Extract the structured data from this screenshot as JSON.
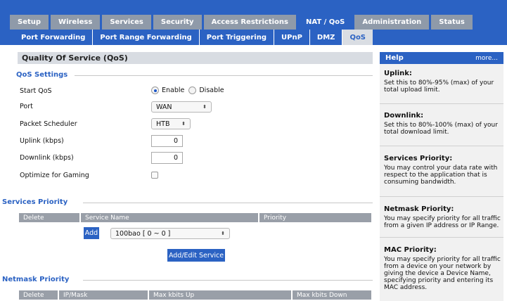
{
  "top_tabs": [
    {
      "label": "Setup"
    },
    {
      "label": "Wireless"
    },
    {
      "label": "Services"
    },
    {
      "label": "Security"
    },
    {
      "label": "Access Restrictions"
    },
    {
      "label": "NAT / QoS"
    },
    {
      "label": "Administration"
    },
    {
      "label": "Status"
    }
  ],
  "active_top_tab": "NAT / QoS",
  "sub_tabs": [
    {
      "label": "Port Forwarding"
    },
    {
      "label": "Port Range Forwarding"
    },
    {
      "label": "Port Triggering"
    },
    {
      "label": "UPnP"
    },
    {
      "label": "DMZ"
    },
    {
      "label": "QoS"
    }
  ],
  "active_sub_tab": "QoS",
  "page_title": "Quality Of Service (QoS)",
  "qos_settings": {
    "title": "QoS Settings",
    "start_qos_label": "Start QoS",
    "enable_label": "Enable",
    "disable_label": "Disable",
    "start_qos_value": "Enable",
    "port_label": "Port",
    "port_value": "WAN",
    "scheduler_label": "Packet Scheduler",
    "scheduler_value": "HTB",
    "uplink_label": "Uplink (kbps)",
    "uplink_value": "0",
    "downlink_label": "Downlink (kbps)",
    "downlink_value": "0",
    "gaming_label": "Optimize for Gaming",
    "gaming_checked": false
  },
  "services_priority": {
    "title": "Services Priority",
    "columns": [
      "Delete",
      "Service Name",
      "Priority"
    ],
    "add_label": "Add",
    "service_value": "100bao [ 0 ~ 0 ]",
    "edit_button": "Add/Edit Service"
  },
  "netmask_priority": {
    "title": "Netmask Priority",
    "columns": [
      "Delete",
      "IP/Mask",
      "Max kbits Up",
      "Max kbits Down"
    ]
  },
  "help": {
    "title": "Help",
    "more": "more...",
    "sections": [
      {
        "title": "Uplink:",
        "text": "Set this to 80%-95% (max) of your total upload limit."
      },
      {
        "title": "Downlink:",
        "text": "Set this to 80%-100% (max) of your total download limit."
      },
      {
        "title": "Services Priority:",
        "text": "You may control your data rate with respect to the application that is consuming bandwidth."
      },
      {
        "title": "Netmask Priority:",
        "text": "You may specify priority for all traffic from a given IP address or IP Range."
      },
      {
        "title": "MAC Priority:",
        "text": "You may specify priority for all traffic from a device on your network by giving the device a Device Name, specifying priority and entering its MAC address."
      }
    ]
  },
  "colors": {
    "accent": "#2b62c3",
    "inactive_tab": "#8f9aa9",
    "header_gray": "#d8dce2"
  }
}
